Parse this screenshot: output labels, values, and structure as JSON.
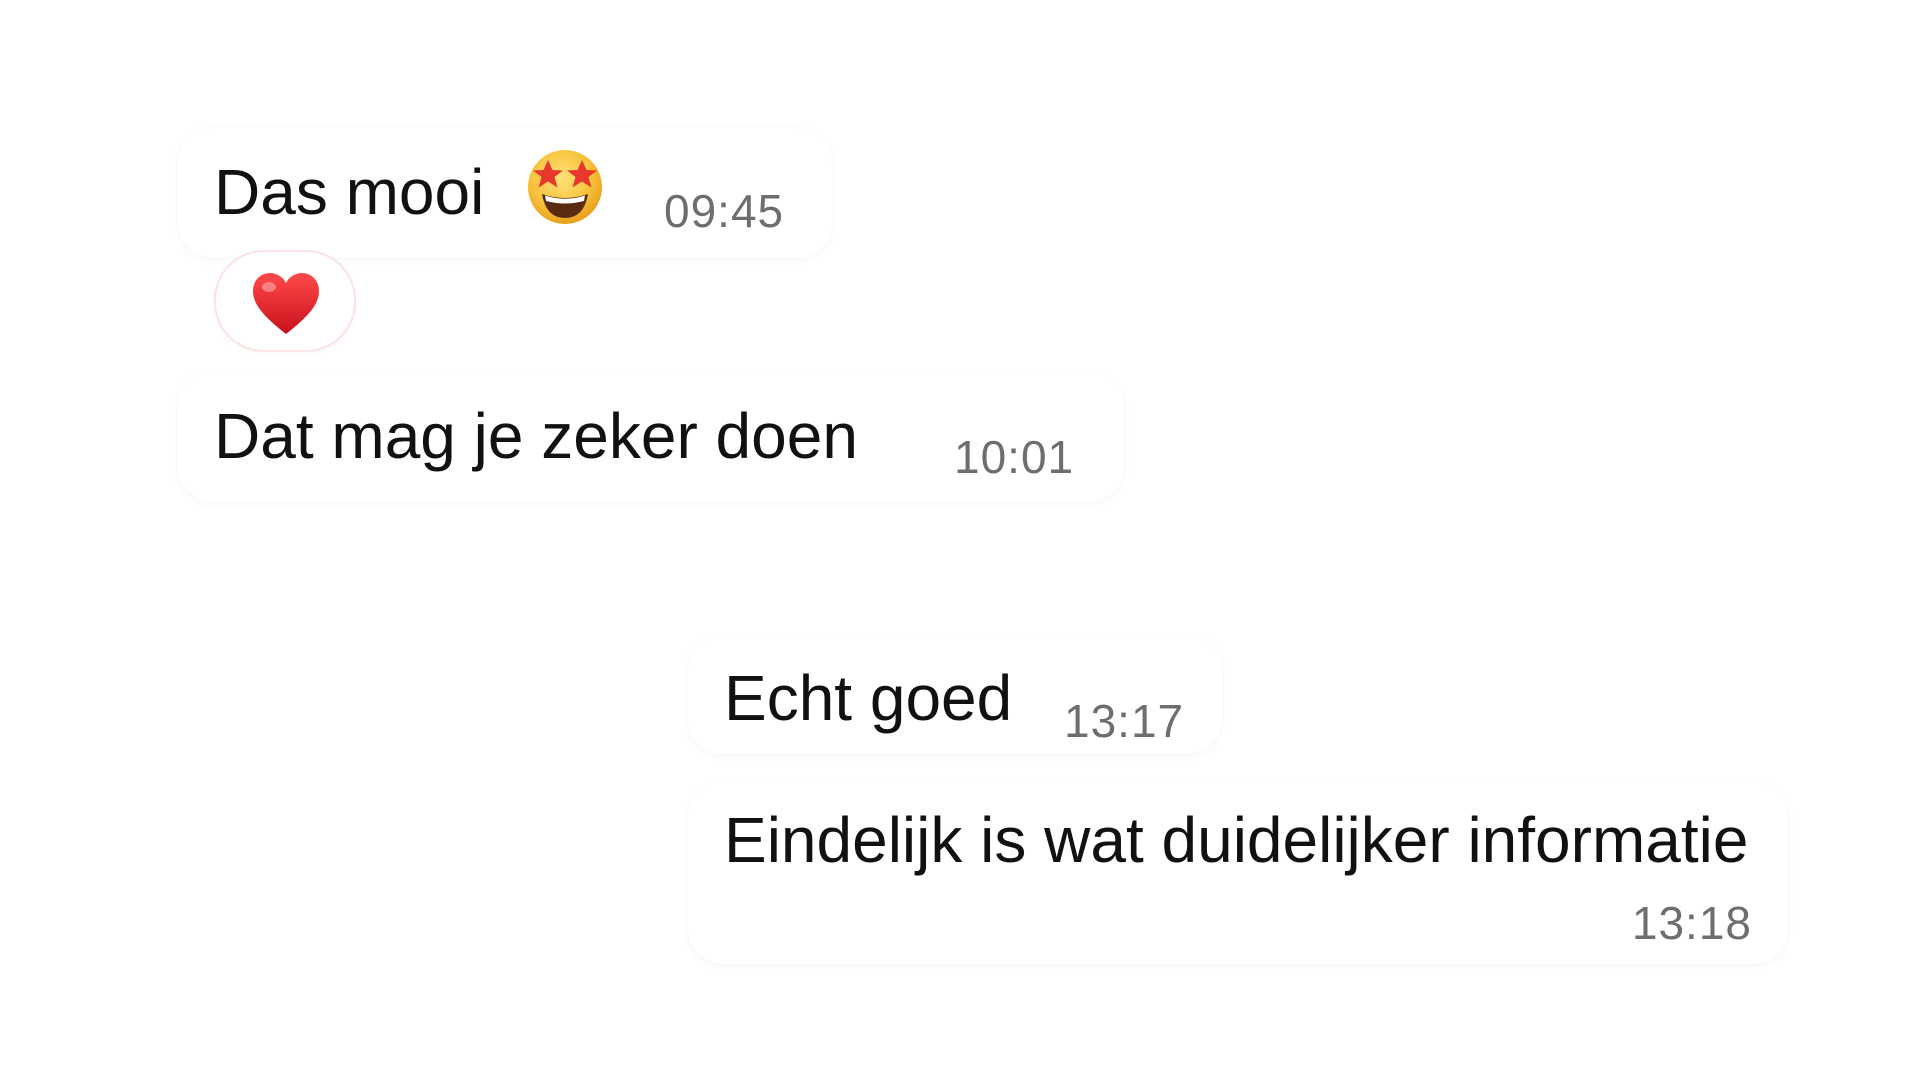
{
  "messages": {
    "m1": {
      "text": "Das mooi",
      "emoji": "star-struck-emoji",
      "time": "09:45"
    },
    "m1_reaction": {
      "emoji": "red-heart-emoji"
    },
    "m2": {
      "text": "Dat mag je zeker doen",
      "time": "10:01"
    },
    "m3": {
      "text": "Echt goed",
      "time": "13:17"
    },
    "m4": {
      "text": "Eindelijk is wat duidelijker informatie",
      "time": "13:18"
    }
  },
  "colors": {
    "background": "#ffffff",
    "bubble": "#ffffff",
    "text": "#111111",
    "timestamp": "#6e6e6e",
    "heart": "#e0212b",
    "emoji_face": "#f7c13a"
  }
}
